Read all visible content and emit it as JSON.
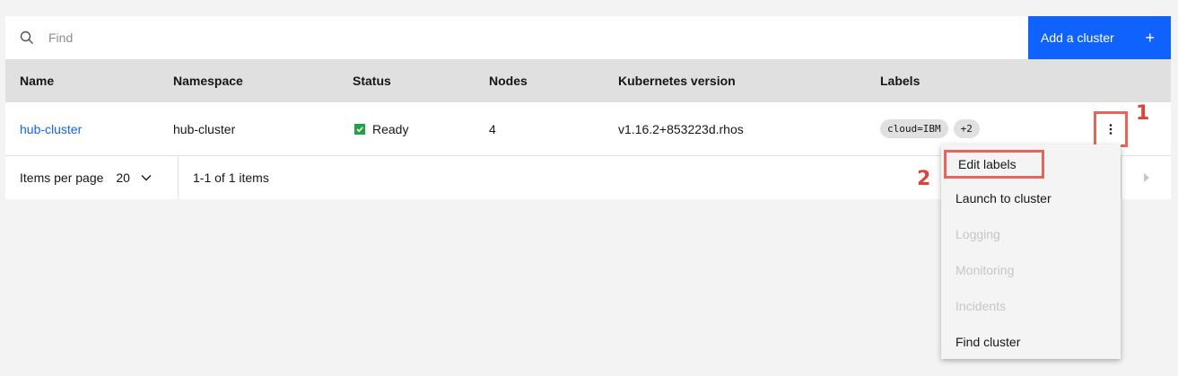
{
  "search": {
    "placeholder": "Find"
  },
  "toolbar": {
    "add_label": "Add a cluster",
    "add_icon": "plus-icon"
  },
  "table": {
    "columns": [
      "Name",
      "Namespace",
      "Status",
      "Nodes",
      "Kubernetes version",
      "Labels"
    ],
    "rows": [
      {
        "name": "hub-cluster",
        "namespace": "hub-cluster",
        "status": "Ready",
        "nodes": "4",
        "version": "v1.16.2+853223d.rhos",
        "labels": [
          "cloud=IBM"
        ],
        "more_labels": "+2"
      }
    ]
  },
  "pagination": {
    "items_per_page_label": "Items per page",
    "items_per_page_value": "20",
    "range_text": "1-1 of 1 items"
  },
  "overflow_menu": {
    "items": [
      {
        "label": "Edit labels",
        "enabled": true
      },
      {
        "label": "Launch to cluster",
        "enabled": true
      },
      {
        "label": "Logging",
        "enabled": false
      },
      {
        "label": "Monitoring",
        "enabled": false
      },
      {
        "label": "Incidents",
        "enabled": false
      },
      {
        "label": "Find cluster",
        "enabled": true
      }
    ]
  },
  "annotations": {
    "step1": "1",
    "step2": "2"
  },
  "colors": {
    "accent": "#0f62fe",
    "ready": "#24a148",
    "callout": "#e8645a"
  }
}
